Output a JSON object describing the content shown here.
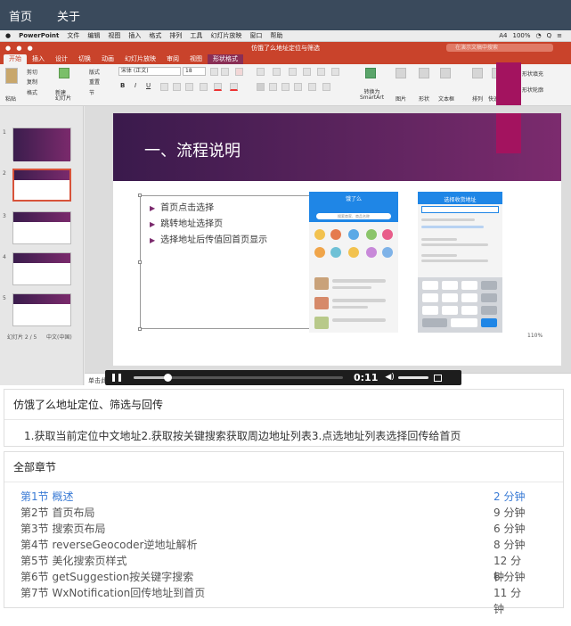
{
  "nav": {
    "home": "首页",
    "about": "关于"
  },
  "mac_menubar": {
    "apple": "●",
    "items": [
      "PowerPoint",
      "文件",
      "编辑",
      "视图",
      "插入",
      "格式",
      "排列",
      "工具",
      "幻灯片放映",
      "窗口",
      "帮助"
    ],
    "right": [
      "A4",
      "100%",
      "◔",
      "Q",
      "≡"
    ]
  },
  "ppt": {
    "doc_title": "仿饿了么地址定位与筛选",
    "search_placeholder": "在演示文稿中搜索",
    "tabs": [
      "开始",
      "插入",
      "设计",
      "切换",
      "动画",
      "幻灯片放映",
      "审阅",
      "视图",
      "形状格式"
    ],
    "ribbon": {
      "paste": "粘贴",
      "cut": "剪切",
      "copy": "复制",
      "format": "格式",
      "new_slide": "新建\n幻灯片",
      "layout": "版式",
      "reset": "重置",
      "section": "节",
      "font": "宋体 (正文)",
      "size": "18",
      "convert_smartart": "转换为\nSmartArt",
      "picture": "图片",
      "shape": "形状",
      "textbox": "文本框",
      "arrange": "排列",
      "quick_styles": "快速样式",
      "shape_fill": "形状填充",
      "shape_outline": "形状轮廓"
    },
    "slide": {
      "title": "一、流程说明",
      "bullets": [
        "首页点击选择",
        "跳转地址选择页",
        "选择地址后传值回首页显示"
      ]
    },
    "phone1": {
      "title": "饿了么",
      "search": "搜索商家、商品名称"
    },
    "phone2": {
      "title": "选择收货地址"
    },
    "notes_hint": "单击此处添加备注",
    "status_left": "幻灯片 2 / 5",
    "status_lang": "中文(中国)",
    "zoom": "110%",
    "thumb_nums": [
      "1",
      "2",
      "3",
      "4",
      "5"
    ]
  },
  "player": {
    "time": "0:11",
    "progress": 0.16,
    "volume": 1.0
  },
  "course": {
    "title": "仿饿了么地址定位、筛选与回传",
    "description": "1.获取当前定位中文地址2.获取按关键搜索获取周边地址列表3.点选地址列表选择回传给首页"
  },
  "chapters": {
    "heading": "全部章节",
    "items": [
      {
        "name": "第1节 概述",
        "duration": "2 分钟",
        "current": true
      },
      {
        "name": "第2节 首页布局",
        "duration": "9 分钟",
        "current": false
      },
      {
        "name": "第3节 搜索页布局",
        "duration": "6 分钟",
        "current": false
      },
      {
        "name": "第4节 reverseGeocoder逆地址解析",
        "duration": "8 分钟",
        "current": false
      },
      {
        "name": "第5节 美化搜索页样式",
        "duration": "12 分钟",
        "current": false
      },
      {
        "name": "第6节 getSuggestion按关键字搜索",
        "duration": "6 分钟",
        "current": false
      },
      {
        "name": "第7节 WxNotification回传地址到首页",
        "duration": "11 分钟",
        "current": false
      }
    ]
  }
}
